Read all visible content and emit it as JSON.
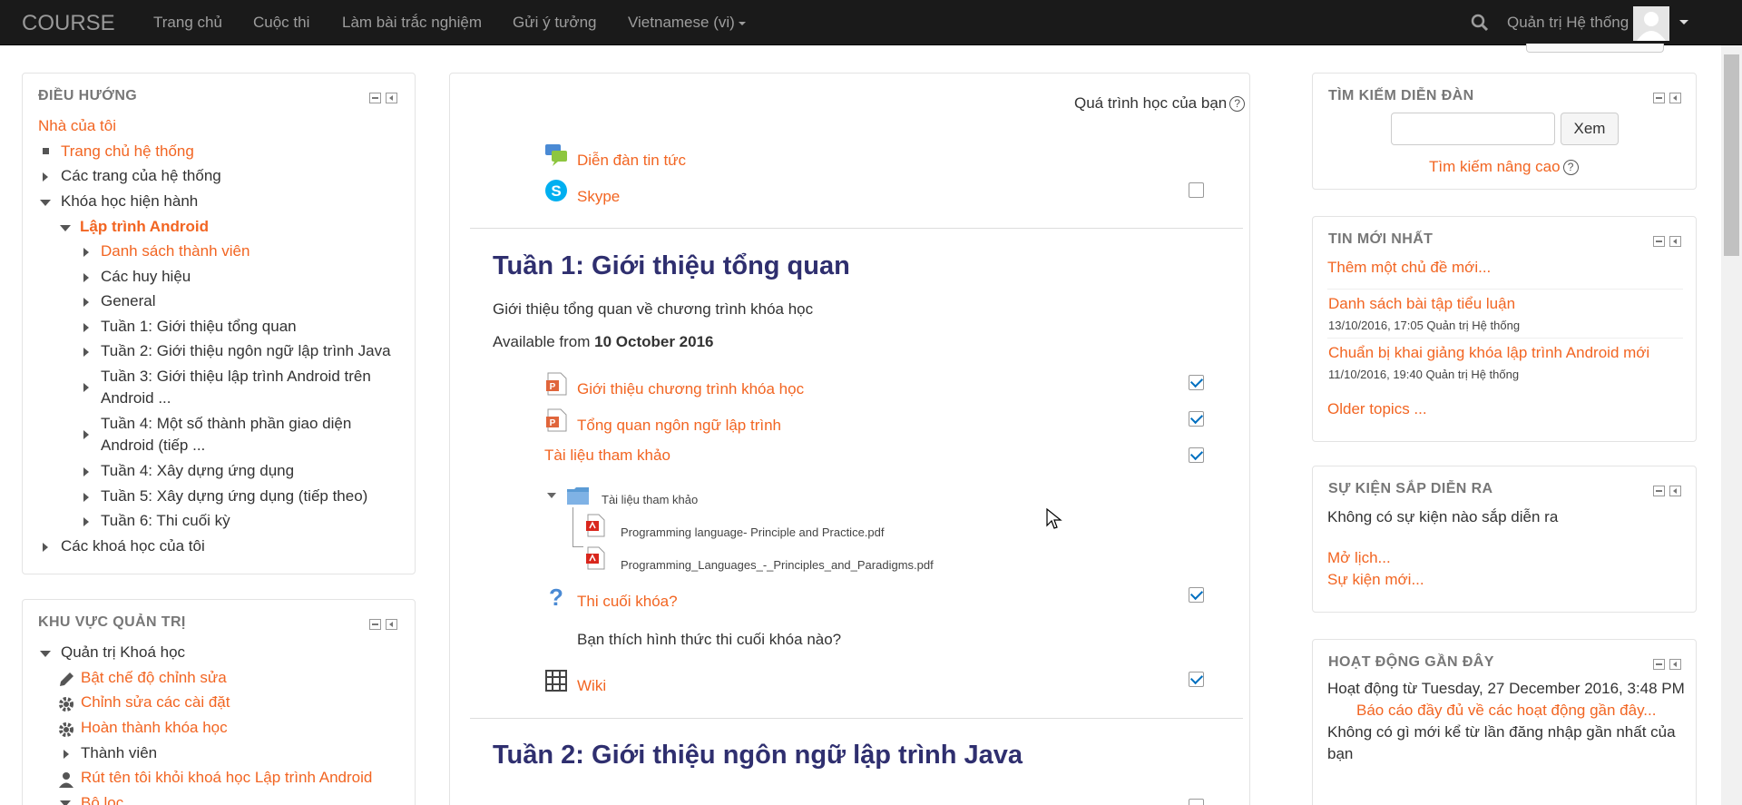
{
  "navbar": {
    "brand": "COURSE",
    "items": [
      "Trang chủ",
      "Cuộc thi",
      "Làm bài trắc nghiệm",
      "Gửi ý tưởng",
      "Vietnamese (vi)"
    ],
    "user_name": "Quản trị Hệ thống"
  },
  "nav_block": {
    "title": "ĐIỀU HƯỚNG",
    "my_home": "Nhà của tôi",
    "site_home": "Trang chủ hệ thống",
    "site_pages": "Các trang của hệ thống",
    "current_courses": "Khóa học hiện hành",
    "course": "Lập trình Android",
    "course_items": [
      "Danh sách thành viên",
      "Các huy hiệu",
      "General",
      "Tuần 1: Giới thiệu tổng quan",
      "Tuần 2: Giới thiệu ngôn ngữ lập trình Java",
      "Tuần 3: Giới thiệu lập trình Android trên",
      "Android ...",
      "Tuần 4: Một số thành phần giao diện",
      "Android (tiếp ...",
      "Tuần 4: Xây dựng ứng dụng",
      "Tuần 5: Xây dựng ứng dụng (tiếp theo)",
      "Tuần 6: Thi cuối kỳ"
    ],
    "my_courses": "Các khoá học của tôi"
  },
  "admin_block": {
    "title": "KHU VỰC QUẢN TRỊ",
    "course_admin": "Quản trị Khoá học",
    "items": [
      "Bật chế độ chỉnh sửa",
      "Chỉnh sửa các cài đặt",
      "Hoàn thành khóa học",
      "Thành viên",
      "Rút tên tôi khỏi khoá học Lập trình Android",
      "Bộ lọc"
    ]
  },
  "main": {
    "progress_label": "Quá trình học của bạn",
    "help": "?",
    "general_activities": [
      "Diễn đàn tin tức",
      "Skype"
    ],
    "week1": {
      "title": "Tuần 1: Giới thiệu tổng quan",
      "summary": "Giới thiệu tổng quan về chương trình khóa học",
      "available_prefix": "Available from",
      "available_date": "10 October 2016",
      "activities": [
        "Giới thiệu chương trình khóa học",
        "Tổng quan ngôn ngữ lập trình",
        "Tài liệu tham khảo"
      ],
      "folder_name": "Tài liệu tham khảo",
      "files": [
        "Programming language- Principle and Practice.pdf",
        "Programming_Languages_-_Principles_and_Paradigms.pdf"
      ],
      "quiz": "Thi cuối khóa?",
      "quiz_desc": "Bạn thích hình thức thi cuối khóa nào?",
      "wiki": "Wiki"
    },
    "week2": {
      "title": "Tuần 2: Giới thiệu ngôn ngữ lập trình Java"
    }
  },
  "search_block": {
    "title": "TÌM KIẾM DIỄN ĐÀN",
    "button": "Xem",
    "advanced": "Tìm kiếm nâng cao"
  },
  "news_block": {
    "title": "TIN MỚI NHẤT",
    "add_topic": "Thêm một chủ đề mới...",
    "posts": [
      {
        "title": "Danh sách bài tập tiểu luận",
        "meta": "13/10/2016, 17:05  Quản trị Hệ thống"
      },
      {
        "title": "Chuẩn bị khai giảng khóa lập trình Android mới",
        "meta": "11/10/2016, 19:40  Quản trị Hệ thống"
      }
    ],
    "older": "Older topics ..."
  },
  "events_block": {
    "title": "SỰ KIỆN SẮP DIỄN RA",
    "none": "Không có sự kiện nào sắp diễn ra",
    "calendar": "Mở lịch...",
    "new_event": "Sự kiện mới..."
  },
  "activity_block": {
    "title": "HOẠT ĐỘNG GẦN ĐÂY",
    "since": "Hoạt động từ Tuesday, 27 December 2016, 3:48 PM",
    "full_report": "Báo cáo đầy đủ về các hoạt động gần đây...",
    "nothing_1": "Không có gì mới kể từ lần đăng nhập gần nhất của",
    "nothing_2": "bạn"
  },
  "colors": {
    "link": "#f26522",
    "navbar": "#1a1a1a",
    "section_title": "#2f2f6f"
  }
}
